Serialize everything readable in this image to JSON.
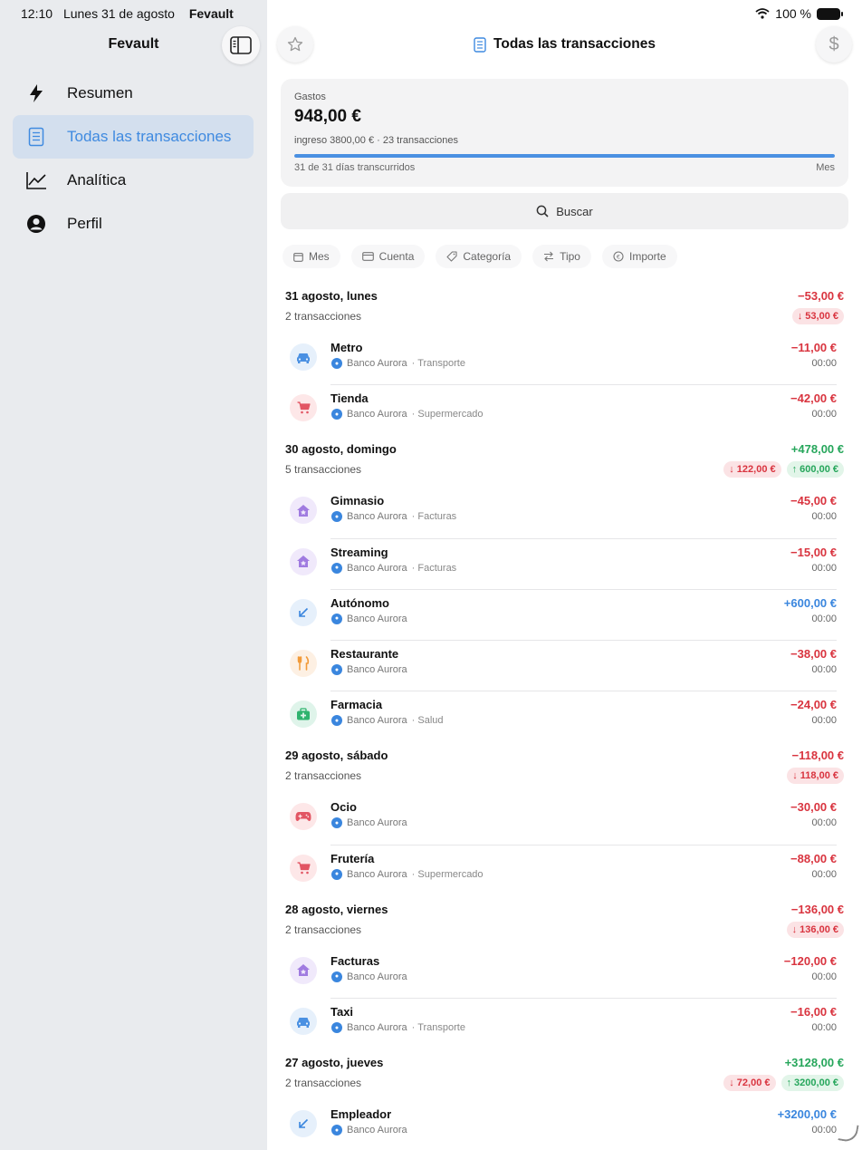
{
  "status": {
    "time": "12:10",
    "date": "Lunes 31 de agosto",
    "app": "Fevault",
    "battery": "100 %"
  },
  "sidebar": {
    "title": "Fevault",
    "items": [
      {
        "label": "Resumen",
        "icon": "bolt-icon",
        "active": false
      },
      {
        "label": "Todas las transacciones",
        "icon": "document-icon",
        "active": true
      },
      {
        "label": "Analítica",
        "icon": "chart-line-icon",
        "active": false
      },
      {
        "label": "Perfil",
        "icon": "person-icon",
        "active": false
      }
    ]
  },
  "header": {
    "title": "Todas las transacciones"
  },
  "summary": {
    "label": "Gastos",
    "value": "948,00 €",
    "sub": "ingreso 3800,00 € · 23 transacciones",
    "days": "31 de 31 días transcurridos",
    "period": "Mes",
    "progress": 1.0
  },
  "search": {
    "placeholder": "Buscar"
  },
  "filters": [
    "Mes",
    "Cuenta",
    "Categoría",
    "Tipo",
    "Importe"
  ],
  "colors": {
    "accent": "#3f8ae0",
    "expense": "#d9343f",
    "income_green": "#26a65b",
    "income_blue": "#3a86de",
    "sidebar_bg": "#e9ebee"
  },
  "days": [
    {
      "title": "31 agosto, lunes",
      "count": "2 transacciones",
      "total": "−53,00 €",
      "total_type": "neg",
      "out": "↓ 53,00 €",
      "in": "",
      "transactions": [
        {
          "name": "Metro",
          "bank": "Banco Aurora",
          "category": "Transporte",
          "amount": "−11,00 €",
          "type": "neg",
          "time": "00:00",
          "icon": "car-icon",
          "bg": "bg-blue"
        },
        {
          "name": "Tienda",
          "bank": "Banco Aurora",
          "category": "Supermercado",
          "amount": "−42,00 €",
          "type": "neg",
          "time": "00:00",
          "icon": "cart-icon",
          "bg": "bg-red"
        }
      ]
    },
    {
      "title": "30 agosto, domingo",
      "count": "5 transacciones",
      "total": "+478,00 €",
      "total_type": "pos",
      "out": "↓ 122,00 €",
      "in": "↑ 600,00 €",
      "transactions": [
        {
          "name": "Gimnasio",
          "bank": "Banco Aurora",
          "category": "Facturas",
          "amount": "−45,00 €",
          "type": "neg",
          "time": "00:00",
          "icon": "house-icon",
          "bg": "bg-purple"
        },
        {
          "name": "Streaming",
          "bank": "Banco Aurora",
          "category": "Facturas",
          "amount": "−15,00 €",
          "type": "neg",
          "time": "00:00",
          "icon": "house-icon",
          "bg": "bg-purple"
        },
        {
          "name": "Autónomo",
          "bank": "Banco Aurora",
          "category": "",
          "amount": "+600,00 €",
          "type": "inc",
          "time": "00:00",
          "icon": "arrow-in-icon",
          "bg": "bg-blue"
        },
        {
          "name": "Restaurante",
          "bank": "Banco Aurora",
          "category": "",
          "amount": "−38,00 €",
          "type": "neg",
          "time": "00:00",
          "icon": "fork-knife-icon",
          "bg": "bg-orange"
        },
        {
          "name": "Farmacia",
          "bank": "Banco Aurora",
          "category": "Salud",
          "amount": "−24,00 €",
          "type": "neg",
          "time": "00:00",
          "icon": "medkit-icon",
          "bg": "bg-green"
        }
      ]
    },
    {
      "title": "29 agosto, sábado",
      "count": "2 transacciones",
      "total": "−118,00 €",
      "total_type": "neg",
      "out": "↓ 118,00 €",
      "in": "",
      "transactions": [
        {
          "name": "Ocio",
          "bank": "Banco Aurora",
          "category": "",
          "amount": "−30,00 €",
          "type": "neg",
          "time": "00:00",
          "icon": "gamepad-icon",
          "bg": "bg-red"
        },
        {
          "name": "Frutería",
          "bank": "Banco Aurora",
          "category": "Supermercado",
          "amount": "−88,00 €",
          "type": "neg",
          "time": "00:00",
          "icon": "cart-icon",
          "bg": "bg-red"
        }
      ]
    },
    {
      "title": "28 agosto, viernes",
      "count": "2 transacciones",
      "total": "−136,00 €",
      "total_type": "neg",
      "out": "↓ 136,00 €",
      "in": "",
      "transactions": [
        {
          "name": "Facturas",
          "bank": "Banco Aurora",
          "category": "",
          "amount": "−120,00 €",
          "type": "neg",
          "time": "00:00",
          "icon": "house-icon",
          "bg": "bg-purple"
        },
        {
          "name": "Taxi",
          "bank": "Banco Aurora",
          "category": "Transporte",
          "amount": "−16,00 €",
          "type": "neg",
          "time": "00:00",
          "icon": "car-icon",
          "bg": "bg-blue"
        }
      ]
    },
    {
      "title": "27 agosto, jueves",
      "count": "2 transacciones",
      "total": "+3128,00 €",
      "total_type": "pos",
      "out": "↓ 72,00 €",
      "in": "↑ 3200,00 €",
      "transactions": [
        {
          "name": "Empleador",
          "bank": "Banco Aurora",
          "category": "",
          "amount": "+3200,00 €",
          "type": "inc",
          "time": "00:00",
          "icon": "arrow-in-icon",
          "bg": "bg-blue"
        }
      ]
    }
  ]
}
